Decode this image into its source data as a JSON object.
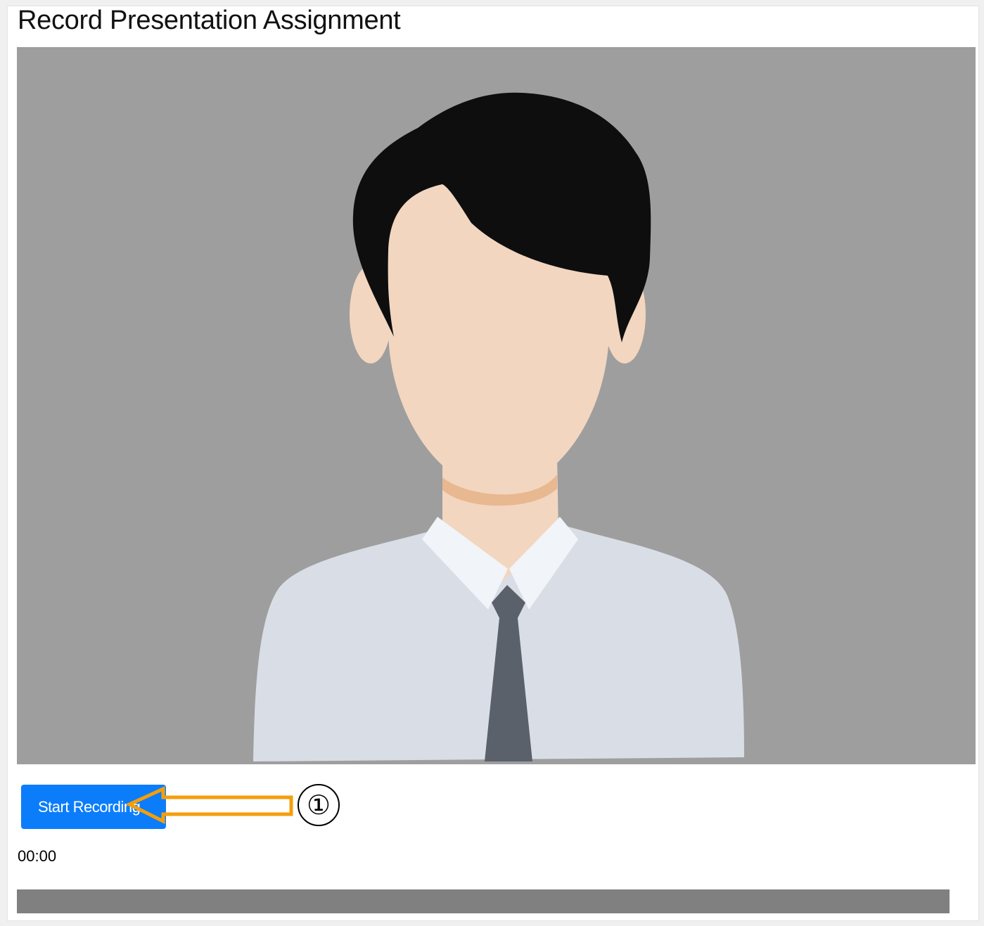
{
  "page": {
    "title": "Record Presentation Assignment"
  },
  "video_preview": {
    "placeholder_icon": "avatar-man-with-tie-icon"
  },
  "controls": {
    "start_recording_label": "Start Recording",
    "timer": "00:00",
    "progress": 0
  },
  "annotation": {
    "step_number": "①",
    "arrow_icon": "left-arrow-icon",
    "arrow_color": "#f59e0b"
  },
  "colors": {
    "accent": "#0b7dfb",
    "video_background": "#9e9e9e",
    "progress_track": "#808080"
  }
}
